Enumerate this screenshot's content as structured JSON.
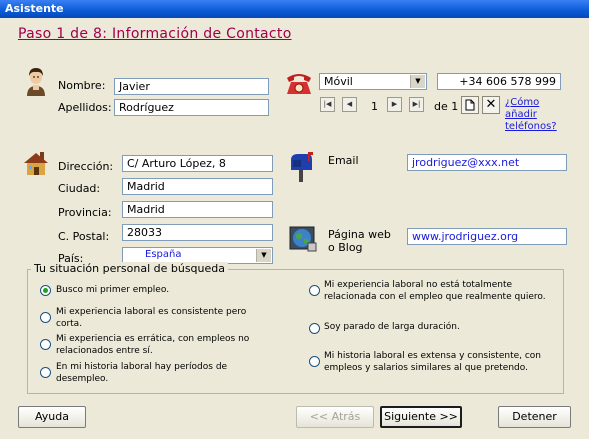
{
  "window": {
    "title": "Asistente"
  },
  "step": {
    "title": "Paso 1 de 8: Información de Contacto"
  },
  "contact": {
    "nombre_label": "Nombre:",
    "nombre_value": "Javier",
    "apellidos_label": "Apellidos:",
    "apellidos_value": "Rodríguez"
  },
  "phone": {
    "type": "Móvil",
    "number": "+34 606 578 999",
    "record": "1",
    "of_label": "de 1",
    "add_link": "¿Cómo añadir teléfonos?"
  },
  "address": {
    "direccion_label": "Dirección:",
    "direccion_value": "C/ Arturo López, 8",
    "ciudad_label": "Ciudad:",
    "ciudad_value": "Madrid",
    "provincia_label": "Provincia:",
    "provincia_value": "Madrid",
    "postal_label": "C. Postal:",
    "postal_value": "28033",
    "pais_label": "País:",
    "pais_value": "España"
  },
  "email": {
    "label": "Email",
    "value": "jrodriguez@xxx.net"
  },
  "web": {
    "label": "Página web o Blog",
    "value": "www.jrodriguez.org"
  },
  "situation": {
    "legend": "Tu situación personal de búsqueda",
    "options": [
      {
        "text": "Busco mi primer empleo.",
        "selected": true
      },
      {
        "text": "Mi experiencia laboral es consistente pero corta.",
        "selected": false
      },
      {
        "text": "Mi experiencia es errática, con empleos no relacionados entre sí.",
        "selected": false
      },
      {
        "text": "En mi historia laboral hay períodos de desempleo.",
        "selected": false
      },
      {
        "text": "Mi experiencia laboral no está totalmente relacionada con el empleo que realmente quiero.",
        "selected": false
      },
      {
        "text": "Soy parado de larga duración.",
        "selected": false
      },
      {
        "text": "Mi historia laboral es extensa y consistente, con empleos y salarios similares al que pretendo.",
        "selected": false
      }
    ]
  },
  "buttons": {
    "help": "Ayuda",
    "back": "<< Atrás",
    "next": "Siguiente >>",
    "stop": "Detener"
  },
  "icons": {
    "person": "person-icon",
    "phone": "telephone-icon",
    "house": "house-icon",
    "mailbox": "mailbox-icon",
    "globe": "globe-icon"
  }
}
